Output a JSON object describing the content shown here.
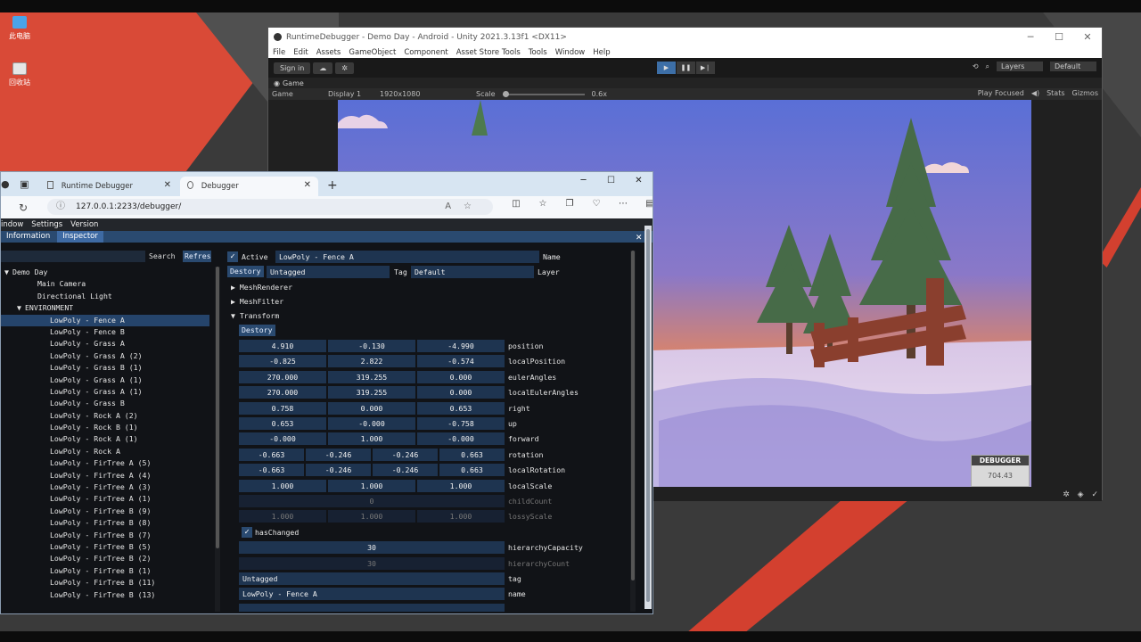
{
  "desktop": {
    "icons": [
      {
        "label": "此电脑"
      },
      {
        "label": "回收站"
      }
    ]
  },
  "unity": {
    "title": "RuntimeDebugger - Demo Day - Android - Unity 2021.3.13f1 <DX11>",
    "menu": [
      "File",
      "Edit",
      "Assets",
      "GameObject",
      "Component",
      "Asset Store Tools",
      "Tools",
      "Window",
      "Help"
    ],
    "sign_in": "Sign in",
    "layers": "Layers",
    "layout": "Default",
    "game_tab": "Game",
    "game_bar": {
      "display_mode": "Game",
      "display": "Display 1",
      "resolution": "1920x1080",
      "scale_label": "Scale",
      "scale_value": "0.6x",
      "play_focused": "Play Focused",
      "stats": "Stats",
      "gizmos": "Gizmos"
    },
    "debugger_badge": {
      "title": "DEBUGGER",
      "value": "704.43"
    }
  },
  "browser": {
    "tabs": [
      {
        "label": "Runtime Debugger",
        "active": false
      },
      {
        "label": "Debugger",
        "active": true
      }
    ],
    "url": "127.0.0.1:2233/debugger/"
  },
  "app": {
    "menu": [
      "indow",
      "Settings",
      "Version"
    ],
    "tabs": [
      "Information",
      "Inspector"
    ],
    "search_label": "Search",
    "refresh_label": "Refresh",
    "hierarchy": [
      {
        "label": "Demo Day",
        "arrow": "▼",
        "indent": 0
      },
      {
        "label": "Main Camera",
        "arrow": "",
        "indent": 2
      },
      {
        "label": "Directional Light",
        "arrow": "",
        "indent": 2
      },
      {
        "label": "ENVIRONMENT",
        "arrow": "▼",
        "indent": 1
      },
      {
        "label": "LowPoly - Fence A",
        "arrow": "",
        "indent": 3,
        "selected": true
      },
      {
        "label": "LowPoly - Fence B",
        "arrow": "",
        "indent": 3
      },
      {
        "label": "LowPoly - Grass A",
        "arrow": "",
        "indent": 3
      },
      {
        "label": "LowPoly - Grass A (2)",
        "arrow": "",
        "indent": 3
      },
      {
        "label": "LowPoly - Grass B (1)",
        "arrow": "",
        "indent": 3
      },
      {
        "label": "LowPoly - Grass A (1)",
        "arrow": "",
        "indent": 3
      },
      {
        "label": "LowPoly - Grass A (1)",
        "arrow": "",
        "indent": 3
      },
      {
        "label": "LowPoly - Grass B",
        "arrow": "",
        "indent": 3
      },
      {
        "label": "LowPoly - Rock A (2)",
        "arrow": "",
        "indent": 3
      },
      {
        "label": "LowPoly - Rock B (1)",
        "arrow": "",
        "indent": 3
      },
      {
        "label": "LowPoly - Rock A (1)",
        "arrow": "",
        "indent": 3
      },
      {
        "label": "LowPoly - Rock A",
        "arrow": "",
        "indent": 3
      },
      {
        "label": "LowPoly - FirTree A (5)",
        "arrow": "",
        "indent": 3
      },
      {
        "label": "LowPoly - FirTree A (4)",
        "arrow": "",
        "indent": 3
      },
      {
        "label": "LowPoly - FirTree A (3)",
        "arrow": "",
        "indent": 3
      },
      {
        "label": "LowPoly - FirTree A (1)",
        "arrow": "",
        "indent": 3
      },
      {
        "label": "LowPoly - FirTree B (9)",
        "arrow": "",
        "indent": 3
      },
      {
        "label": "LowPoly - FirTree B (8)",
        "arrow": "",
        "indent": 3
      },
      {
        "label": "LowPoly - FirTree B (7)",
        "arrow": "",
        "indent": 3
      },
      {
        "label": "LowPoly - FirTree B (5)",
        "arrow": "",
        "indent": 3
      },
      {
        "label": "LowPoly - FirTree B (2)",
        "arrow": "",
        "indent": 3
      },
      {
        "label": "LowPoly - FirTree B (1)",
        "arrow": "",
        "indent": 3
      },
      {
        "label": "LowPoly - FirTree B (11)",
        "arrow": "",
        "indent": 3
      },
      {
        "label": "LowPoly - FirTree B (13)",
        "arrow": "",
        "indent": 3
      }
    ],
    "inspector": {
      "active_label": "Active",
      "name_value": "LowPoly - Fence A",
      "name_label": "Name",
      "destroy_label": "Destory",
      "tag_value": "Untagged",
      "tag_label": "Tag",
      "layer_value": "Default",
      "layer_label": "Layer",
      "components": [
        "MeshRenderer",
        "MeshFilter",
        "Transform"
      ],
      "transform_destroy": "Destory",
      "vectors": [
        {
          "label": "position",
          "values": [
            "4.910",
            "-0.130",
            "-4.990"
          ]
        },
        {
          "label": "localPosition",
          "values": [
            "-0.825",
            "2.822",
            "-0.574"
          ]
        },
        {
          "label": "eulerAngles",
          "values": [
            "270.000",
            "319.255",
            "0.000"
          ]
        },
        {
          "label": "localEulerAngles",
          "values": [
            "270.000",
            "319.255",
            "0.000"
          ]
        },
        {
          "label": "right",
          "values": [
            "0.758",
            "0.000",
            "0.653"
          ]
        },
        {
          "label": "up",
          "values": [
            "0.653",
            "-0.000",
            "-0.758"
          ]
        },
        {
          "label": "forward",
          "values": [
            "-0.000",
            "1.000",
            "-0.000"
          ]
        },
        {
          "label": "rotation",
          "values": [
            "-0.663",
            "-0.246",
            "-0.246",
            "0.663"
          ]
        },
        {
          "label": "localRotation",
          "values": [
            "-0.663",
            "-0.246",
            "-0.246",
            "0.663"
          ]
        },
        {
          "label": "localScale",
          "values": [
            "1.000",
            "1.000",
            "1.000"
          ]
        },
        {
          "label": "childCount",
          "values": [
            "0"
          ],
          "dim": true
        },
        {
          "label": "lossyScale",
          "values": [
            "1.000",
            "1.000",
            "1.000"
          ],
          "dim": true
        }
      ],
      "has_changed_label": "hasChanged",
      "hierarchy_capacity": {
        "label": "hierarchyCapacity",
        "value": "30"
      },
      "hierarchy_count": {
        "label": "hierarchyCount",
        "value": "30"
      },
      "tag_row": {
        "label": "tag",
        "value": "Untagged"
      },
      "name_row": {
        "label": "name",
        "value": "LowPoly - Fence A"
      }
    }
  }
}
